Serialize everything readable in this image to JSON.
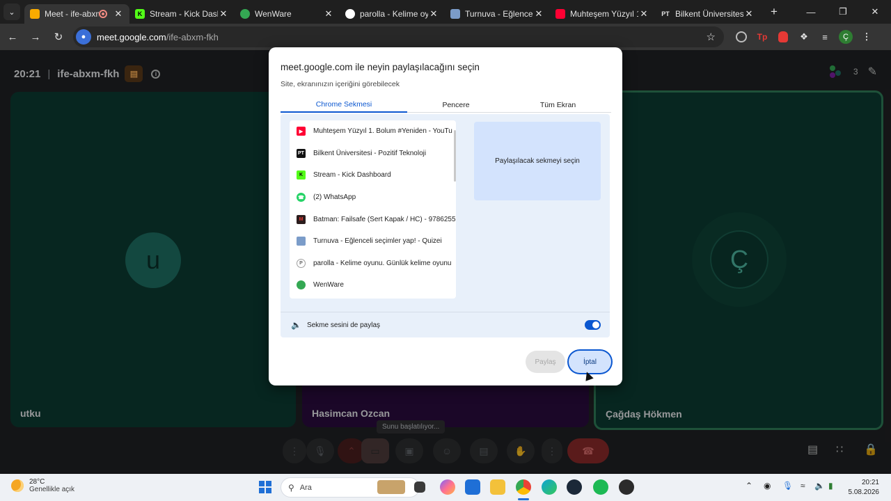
{
  "browser": {
    "tabs": [
      {
        "title": "Meet - ife-abxm-",
        "favicon_color": "#f9ab00",
        "active": true
      },
      {
        "title": "Stream - Kick Dashbo",
        "favicon_color": "#53fc18"
      },
      {
        "title": "WenWare",
        "favicon_color": "#34a853"
      },
      {
        "title": "parolla - Kelime oyun",
        "favicon_color": "#ffffff"
      },
      {
        "title": "Turnuva - Eğlenceli s",
        "favicon_color": "#7b9cc9"
      },
      {
        "title": "Muhteşem Yüzyıl 1. B",
        "favicon_color": "#ff0033"
      },
      {
        "title": "Bilkent Üniversitesi -",
        "favicon_color": "#e3e3e3"
      }
    ],
    "address_host": "meet.google.com",
    "address_path": "/ife-abxm-fkh",
    "profile_initial": "Ç"
  },
  "meet": {
    "time": "20:21",
    "code": "ife-abxm-fkh",
    "participant_count": "3",
    "tiles": [
      {
        "name": "utku",
        "initial": "u",
        "color": "#1e6f63"
      },
      {
        "name": "Hasimcan Ozcan",
        "color": "#2a0b3e"
      },
      {
        "name": "Çağdaş Hökmen",
        "initial": "Ç",
        "color": "#0c3b32"
      }
    ],
    "tooltip": "Sunu başlatılıyor..."
  },
  "dialog": {
    "title": "meet.google.com ile neyin paylaşılacağını seçin",
    "subtitle": "Site, ekranınızın içeriğini görebilecek",
    "tabs": [
      "Chrome Sekmesi",
      "Pencere",
      "Tüm Ekran"
    ],
    "active_tab": "Chrome Sekmesi",
    "tab_list": [
      {
        "title": "Muhteşem Yüzyıl 1. Bolum #Yeniden - YouTu",
        "icon_color": "#ff0033"
      },
      {
        "title": "Bilkent Üniversitesi - Pozitif Teknoloji",
        "icon_color": "#111111"
      },
      {
        "title": "Stream - Kick Dashboard",
        "icon_color": "#53fc18"
      },
      {
        "title": "(2) WhatsApp",
        "icon_color": "#25d366"
      },
      {
        "title": "Batman: Failsafe (Sert Kapak / HC) - 9786255",
        "icon_color": "#2b1d1d"
      },
      {
        "title": "Turnuva - Eğlenceli seçimler yap! - Quizei",
        "icon_color": "#7b9cc9"
      },
      {
        "title": "parolla - Kelime oyunu. Günlük kelime oyunu",
        "icon_color": "#9e9e9e"
      },
      {
        "title": "WenWare",
        "icon_color": "#34a853"
      }
    ],
    "preview_text": "Paylaşılacak sekmeyi seçin",
    "audio_label": "Sekme sesini de paylaş",
    "audio_enabled": true,
    "share_label": "Paylaş",
    "cancel_label": "İptal",
    "accent": "#0b57d0"
  },
  "taskbar": {
    "temperature": "28°C",
    "weather": "Genellikle açık",
    "search_placeholder": "Ara",
    "time": "20:21",
    "date": "5.08.2026"
  }
}
